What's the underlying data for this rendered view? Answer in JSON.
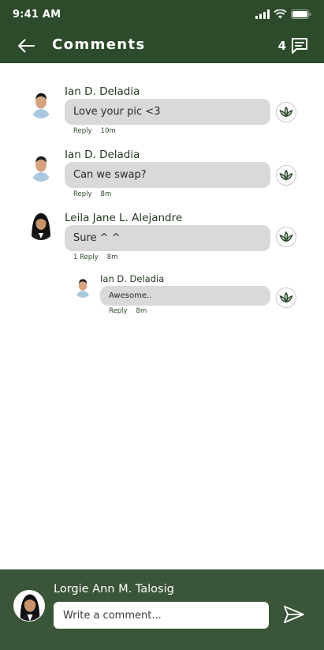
{
  "status_bar": {
    "time": "9:41 AM",
    "icons": [
      "signal-icon",
      "wifi-icon",
      "battery-icon"
    ]
  },
  "header": {
    "title": "Comments",
    "count": "4",
    "back_icon": "arrow-left-icon",
    "comments_icon": "message-square-icon"
  },
  "comments": [
    {
      "name": "Ian D. Deladia",
      "text": "Love your pic <3",
      "reply_label": "Reply",
      "time": "10m"
    },
    {
      "name": "Ian D. Deladia",
      "text": "Can we swap?",
      "reply_label": "Reply",
      "time": "8m"
    },
    {
      "name": "Leila Jane L. Alejandre",
      "text": "Sure ^ ^",
      "reply_label": "1 Reply",
      "time": "8m",
      "replies": [
        {
          "name": "Ian D. Deladia",
          "text": "Awesome..",
          "reply_label": "Reply",
          "time": "8m"
        }
      ]
    }
  ],
  "composer": {
    "user_name": "Lorgie Ann M. Talosig",
    "placeholder": "Write a comment...",
    "send_icon": "send-icon"
  },
  "colors": {
    "header_bg": "#2d4a2b",
    "composer_bg": "#3a5537",
    "bubble_bg": "#d9d9d9",
    "accent": "#2d4a2b"
  }
}
